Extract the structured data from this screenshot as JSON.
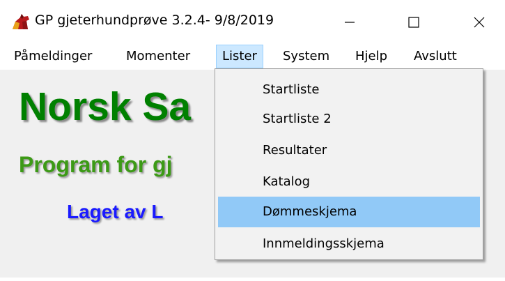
{
  "window": {
    "title": "GP gjeterhundprøve 3.2.4- 9/8/2019",
    "icon": "horse-head-icon",
    "controls": [
      "minimize-icon",
      "maximize-icon",
      "close-icon"
    ]
  },
  "menubar": {
    "items": [
      "Påmeldinger",
      "Momenter",
      "Lister",
      "System",
      "Hjelp",
      "Avslutt"
    ],
    "active": "Lister"
  },
  "dropdown": {
    "items": [
      "Startliste",
      "Startliste 2",
      "Resultater",
      "Katalog",
      "Dømmeskjema",
      "Innmeldingsskjema"
    ],
    "highlighted": "Dømmeskjema"
  },
  "banner": {
    "title": "Norsk Sa",
    "subtitle": "Program for gj",
    "author": "Laget av L"
  },
  "colors": {
    "title_green": "#008000",
    "subtitle_green": "#3c9a16",
    "author_blue": "#1a1aff",
    "menu_active": "#cce8ff",
    "dropdown_highlight": "#91c9f7",
    "client_bg": "#f0f0f0"
  }
}
